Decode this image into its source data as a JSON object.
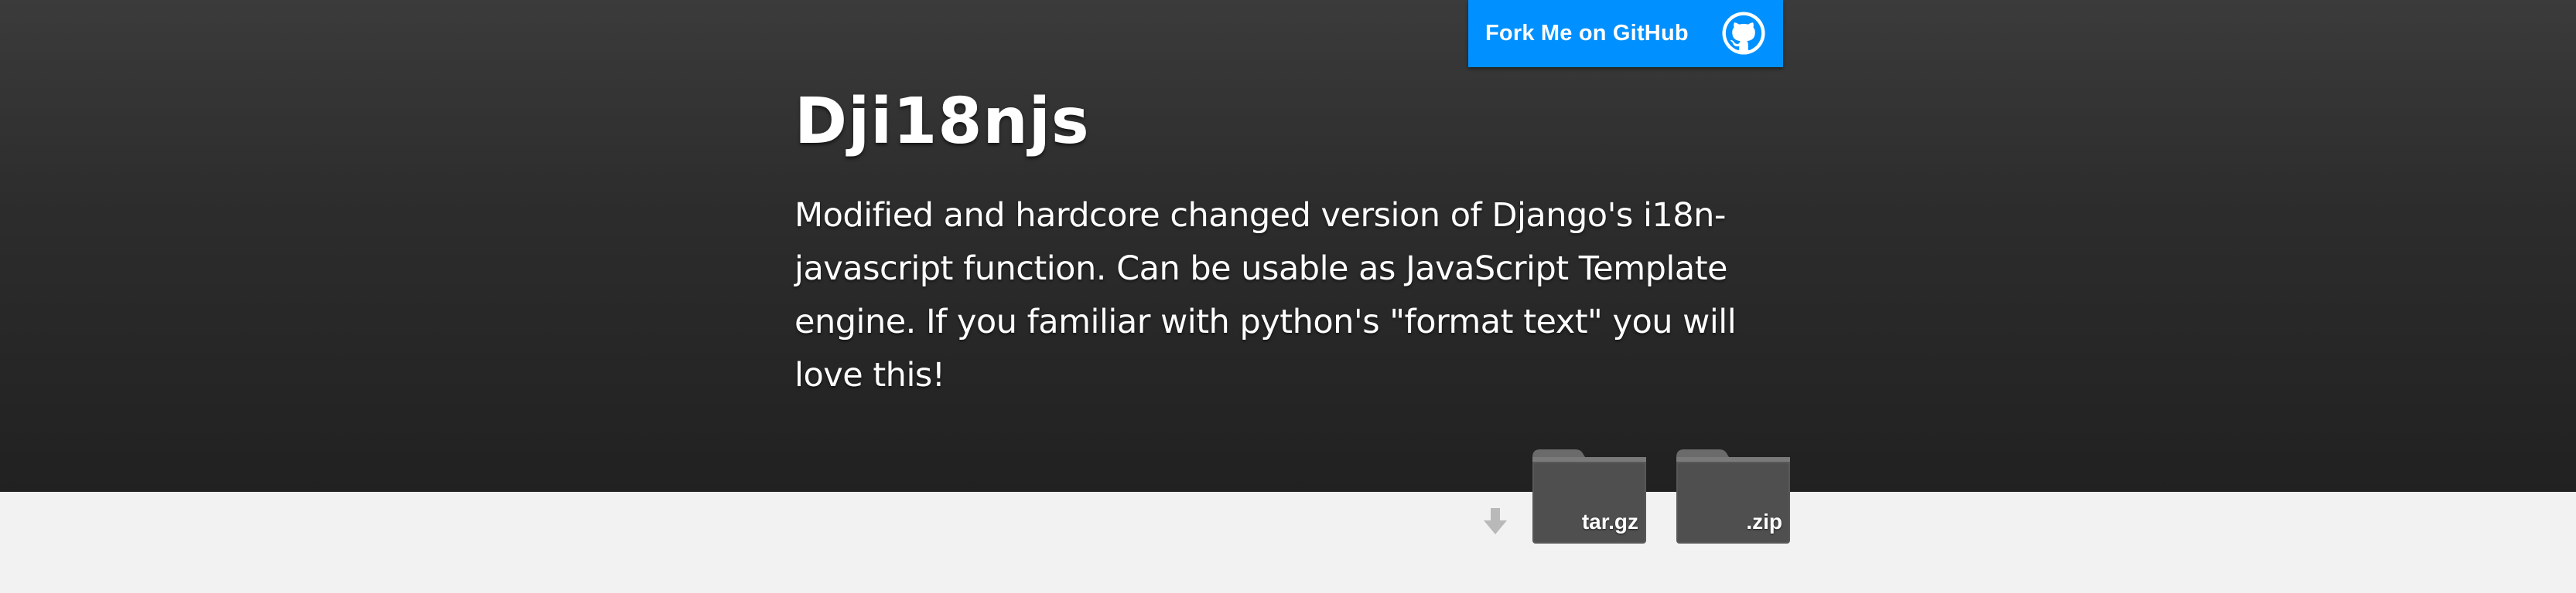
{
  "header": {
    "fork_button_label": "Fork Me on GitHub",
    "fork_icon": "github-octocat-icon",
    "title": "Dji18njs",
    "description": "Modified and hardcore changed version of Django's i18n-javascript function. Can be usable as JavaScript Template engine. If you familiar with python's \"format text\" you will love this!"
  },
  "downloads": {
    "arrow_icon": "download-arrow-icon",
    "tar_label": "tar.gz",
    "zip_label": ".zip"
  },
  "colors": {
    "fork_button": "#0090ff",
    "header_dark": "#212121",
    "page_background": "#f2f2f2",
    "folder_gray": "#555555"
  }
}
